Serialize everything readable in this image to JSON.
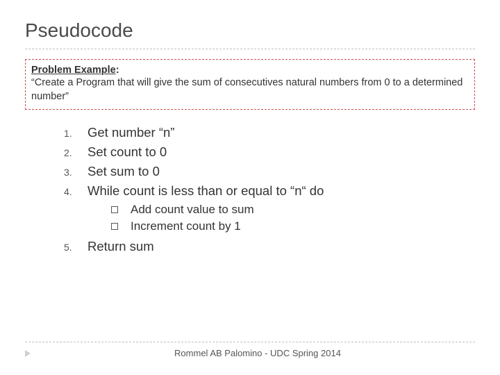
{
  "title": "Pseudocode",
  "problem": {
    "label": "Problem Example",
    "text": "“Create a Program that will give the sum of consecutives natural numbers from 0 to a determined number”"
  },
  "steps": [
    {
      "num": "1.",
      "text": "Get number “n”"
    },
    {
      "num": "2.",
      "text": "Set count  to 0"
    },
    {
      "num": "3.",
      "text": "Set sum to 0"
    },
    {
      "num": "4.",
      "text": "While count is less than or equal to “n“ do"
    }
  ],
  "substeps": [
    "Add count value to sum",
    "Increment count by 1"
  ],
  "step5": {
    "num": "5.",
    "text": "Return sum"
  },
  "footer": "Rommel AB Palomino - UDC Spring 2014"
}
